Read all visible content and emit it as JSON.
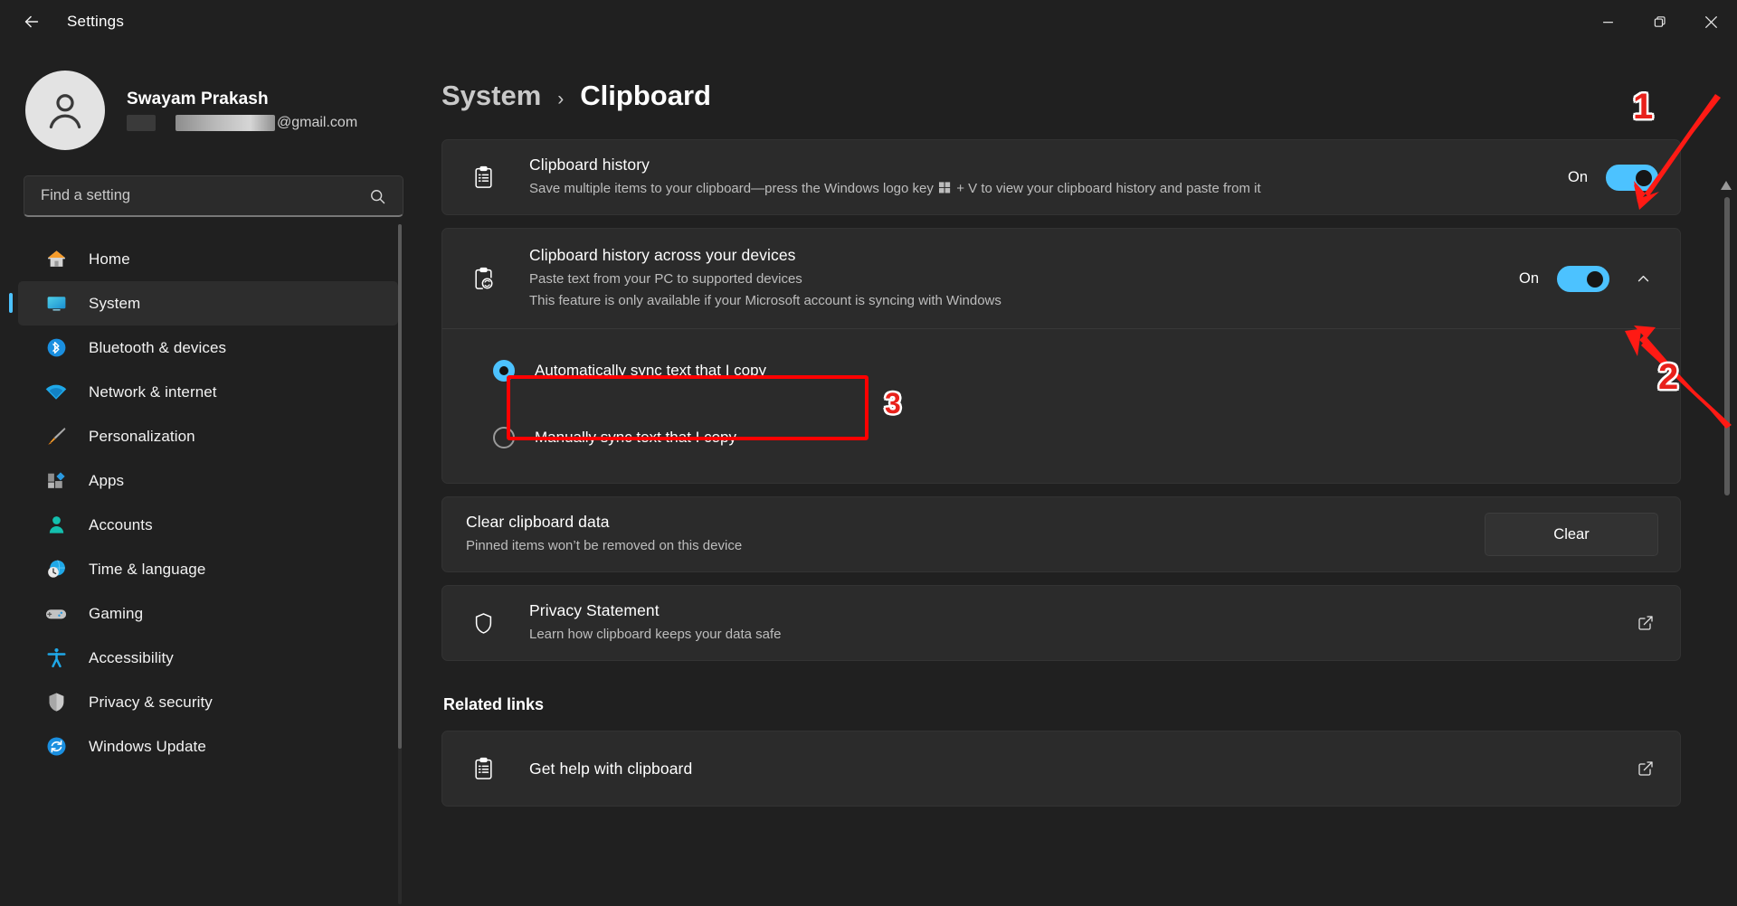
{
  "window": {
    "title": "Settings",
    "back_icon": "back-arrow-icon",
    "minimize_label": "Minimize",
    "maximize_label": "Restore",
    "close_label": "Close"
  },
  "account": {
    "name": "Swayam Prakash",
    "email_tail": "@gmail.com"
  },
  "search": {
    "placeholder": "Find a setting",
    "value": ""
  },
  "sidebar": {
    "items": [
      {
        "label": "Home",
        "icon": "home-icon",
        "active": false
      },
      {
        "label": "System",
        "icon": "system-icon",
        "active": true
      },
      {
        "label": "Bluetooth & devices",
        "icon": "bluetooth-icon",
        "active": false
      },
      {
        "label": "Network & internet",
        "icon": "wifi-icon",
        "active": false
      },
      {
        "label": "Personalization",
        "icon": "paintbrush-icon",
        "active": false
      },
      {
        "label": "Apps",
        "icon": "apps-icon",
        "active": false
      },
      {
        "label": "Accounts",
        "icon": "accounts-icon",
        "active": false
      },
      {
        "label": "Time & language",
        "icon": "clock-globe-icon",
        "active": false
      },
      {
        "label": "Gaming",
        "icon": "gamepad-icon",
        "active": false
      },
      {
        "label": "Accessibility",
        "icon": "accessibility-icon",
        "active": false
      },
      {
        "label": "Privacy & security",
        "icon": "shield-icon",
        "active": false
      },
      {
        "label": "Windows Update",
        "icon": "update-icon",
        "active": false
      }
    ]
  },
  "breadcrumb": {
    "parent": "System",
    "separator": "›",
    "current": "Clipboard"
  },
  "settings": {
    "clipboard_history": {
      "title": "Clipboard history",
      "description_part1": "Save multiple items to your clipboard—press the Windows logo key",
      "description_part2": "+ V to view your clipboard history and paste from it",
      "state_label": "On",
      "icon": "clipboard-list-icon"
    },
    "cross_device": {
      "title": "Clipboard history across your devices",
      "description_line1": "Paste text from your PC to supported devices",
      "description_line2": "This feature is only available if your Microsoft account is syncing with Windows",
      "state_label": "On",
      "icon": "clipboard-sync-icon",
      "expander_icon": "chevron-up-icon",
      "options": [
        {
          "label": "Automatically sync text that I copy",
          "checked": true
        },
        {
          "label": "Manually sync text that I copy",
          "checked": false
        }
      ]
    },
    "clear_clipboard": {
      "title": "Clear clipboard data",
      "description": "Pinned items won’t be removed on this device",
      "button_label": "Clear"
    },
    "privacy_statement": {
      "title": "Privacy Statement",
      "description": "Learn how clipboard keeps your data safe",
      "icon": "shield-outline-icon",
      "link_icon": "open-external-icon"
    }
  },
  "related_links": {
    "heading": "Related links",
    "items": [
      {
        "label": "Get help with clipboard",
        "icon": "clipboard-list-icon",
        "link_icon": "open-external-icon"
      }
    ]
  },
  "annotations": {
    "markers": [
      "1",
      "2",
      "3"
    ],
    "accent_color": "#ff0000"
  },
  "colors": {
    "accent": "#4cc2ff",
    "window_bg": "#202020",
    "card_bg": "#2b2b2b",
    "annotation_red": "#ff0000"
  }
}
